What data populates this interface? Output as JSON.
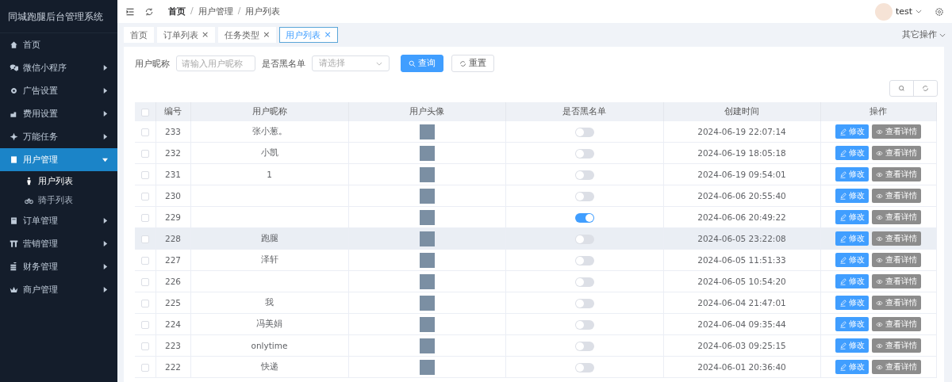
{
  "sidebar": {
    "title": "同城跑腿后台管理系统",
    "items": [
      {
        "label": "首页",
        "has_arrow": false,
        "selected": false
      },
      {
        "label": "微信小程序",
        "has_arrow": true,
        "expanded": false,
        "selected": false
      },
      {
        "label": "广告设置",
        "has_arrow": true,
        "expanded": false,
        "selected": false
      },
      {
        "label": "费用设置",
        "has_arrow": true,
        "expanded": false,
        "selected": false
      },
      {
        "label": "万能任务",
        "has_arrow": true,
        "expanded": false,
        "selected": false
      },
      {
        "label": "用户管理",
        "has_arrow": true,
        "expanded": true,
        "selected": true,
        "children": [
          {
            "label": "用户列表",
            "selected": true
          },
          {
            "label": "骑手列表",
            "selected": false
          }
        ]
      },
      {
        "label": "订单管理",
        "has_arrow": true,
        "expanded": false,
        "selected": false
      },
      {
        "label": "营销管理",
        "has_arrow": true,
        "expanded": false,
        "selected": false
      },
      {
        "label": "财务管理",
        "has_arrow": true,
        "expanded": false,
        "selected": false
      },
      {
        "label": "商户管理",
        "has_arrow": true,
        "expanded": false,
        "selected": false
      }
    ]
  },
  "header": {
    "breadcrumb": [
      {
        "label": "首页"
      },
      {
        "separator": "/",
        "label": "用户管理"
      },
      {
        "separator": "/",
        "label": "用户列表"
      }
    ],
    "user": "test"
  },
  "tabs": [
    {
      "label": "首页",
      "selected": false
    },
    {
      "label": "订单列表",
      "close": "×",
      "selected": false
    },
    {
      "label": "任务类型",
      "close": "×",
      "selected": false
    },
    {
      "label": "用户列表",
      "close": "×",
      "selected": true
    }
  ],
  "other_actions": "其它操作",
  "filters": {
    "nickname_label": "用户昵称",
    "nickname_placeholder": "请输入用户昵称",
    "blacklist_label": "是否黑名单",
    "blacklist_placeholder": "请选择",
    "search_button": "查询",
    "reset_button": "重置"
  },
  "table": {
    "all_checked": false,
    "columns": [
      "编号",
      "用户昵称",
      "用户头像",
      "是否黑名单",
      "创建时间",
      "操作"
    ],
    "rows": [
      {
        "checked": false,
        "id": "233",
        "nickname": "张小葱。",
        "blacklisted": false,
        "created": "2024-06-19 22:07:14",
        "highlighted": false,
        "edit": "修改",
        "detail": "查看详情"
      },
      {
        "checked": false,
        "id": "232",
        "nickname": "小凯",
        "blacklisted": false,
        "created": "2024-06-19 18:05:18",
        "highlighted": false,
        "edit": "修改",
        "detail": "查看详情"
      },
      {
        "checked": false,
        "id": "231",
        "nickname": "1",
        "blacklisted": false,
        "created": "2024-06-19 09:54:01",
        "highlighted": false,
        "edit": "修改",
        "detail": "查看详情"
      },
      {
        "checked": false,
        "id": "230",
        "blacklisted": false,
        "created": "2024-06-06 20:55:40",
        "highlighted": false,
        "edit": "修改",
        "detail": "查看详情"
      },
      {
        "checked": false,
        "id": "229",
        "blacklisted": true,
        "created": "2024-06-06 20:49:22",
        "highlighted": false,
        "edit": "修改",
        "detail": "查看详情"
      },
      {
        "checked": false,
        "id": "228",
        "nickname": "跑腿",
        "blacklisted": false,
        "created": "2024-06-05 23:22:08",
        "highlighted": true,
        "edit": "修改",
        "detail": "查看详情"
      },
      {
        "checked": false,
        "id": "227",
        "nickname": "泽轩",
        "blacklisted": false,
        "created": "2024-06-05 11:51:33",
        "highlighted": false,
        "edit": "修改",
        "detail": "查看详情"
      },
      {
        "checked": false,
        "id": "226",
        "blacklisted": false,
        "created": "2024-06-05 10:54:20",
        "highlighted": false,
        "edit": "修改",
        "detail": "查看详情"
      },
      {
        "checked": false,
        "id": "225",
        "nickname": "我",
        "blacklisted": false,
        "created": "2024-06-04 21:47:01",
        "highlighted": false,
        "edit": "修改",
        "detail": "查看详情"
      },
      {
        "checked": false,
        "id": "224",
        "nickname": "冯美娟",
        "blacklisted": false,
        "created": "2024-06-04 09:35:44",
        "highlighted": false,
        "edit": "修改",
        "detail": "查看详情"
      },
      {
        "checked": false,
        "id": "223",
        "nickname": "onlytime",
        "blacklisted": false,
        "created": "2024-06-03 09:25:15",
        "highlighted": false,
        "edit": "修改",
        "detail": "查看详情"
      },
      {
        "checked": false,
        "id": "222",
        "nickname": "快递",
        "blacklisted": false,
        "created": "2024-06-01 20:36:40",
        "highlighted": false,
        "edit": "修改",
        "detail": "查看详情"
      }
    ]
  }
}
